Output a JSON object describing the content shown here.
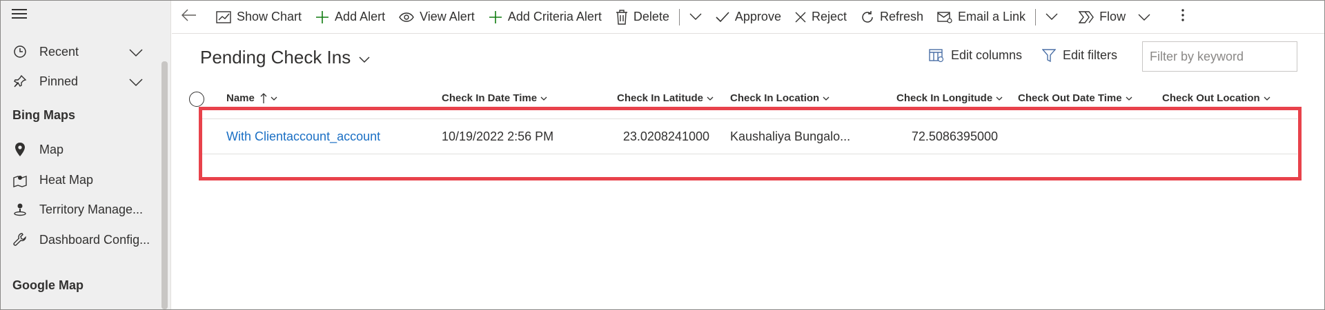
{
  "sidebar": {
    "items": [
      {
        "label": "Recent",
        "icon": "clock-icon"
      },
      {
        "label": "Pinned",
        "icon": "pin-icon"
      }
    ],
    "groups": [
      {
        "heading": "Bing Maps",
        "items": [
          {
            "label": "Map",
            "icon": "location-pin-icon"
          },
          {
            "label": "Heat Map",
            "icon": "heat-map-icon"
          },
          {
            "label": "Territory Manage...",
            "icon": "territory-icon"
          },
          {
            "label": "Dashboard Config...",
            "icon": "wrench-icon"
          }
        ]
      },
      {
        "heading": "Google Map",
        "items": []
      }
    ]
  },
  "commandbar": {
    "show_chart": "Show Chart",
    "add_alert": "Add Alert",
    "view_alert": "View Alert",
    "add_criteria_alert": "Add Criteria Alert",
    "delete": "Delete",
    "approve": "Approve",
    "reject": "Reject",
    "refresh": "Refresh",
    "email_link": "Email a Link",
    "flow": "Flow"
  },
  "view": {
    "title": "Pending Check Ins",
    "edit_columns": "Edit columns",
    "edit_filters": "Edit filters",
    "filter_placeholder": "Filter by keyword"
  },
  "grid": {
    "columns": [
      {
        "label": "Name",
        "sorted": "ascending"
      },
      {
        "label": "Check In Date Time"
      },
      {
        "label": "Check In Latitude"
      },
      {
        "label": "Check In Location"
      },
      {
        "label": "Check In Longitude"
      },
      {
        "label": "Check Out Date Time"
      },
      {
        "label": "Check Out Location"
      }
    ],
    "rows": [
      {
        "name": "With Clientaccount_account",
        "check_in_datetime": "10/19/2022 2:56 PM",
        "check_in_latitude": "23.0208241000",
        "check_in_location": "Kaushaliya Bungalo...",
        "check_in_longitude": "72.5086395000",
        "check_out_datetime": "",
        "check_out_location": ""
      }
    ]
  },
  "colors": {
    "link": "#1a6fc4",
    "highlight": "#e8424b",
    "sidebar_bg": "#efefef"
  }
}
